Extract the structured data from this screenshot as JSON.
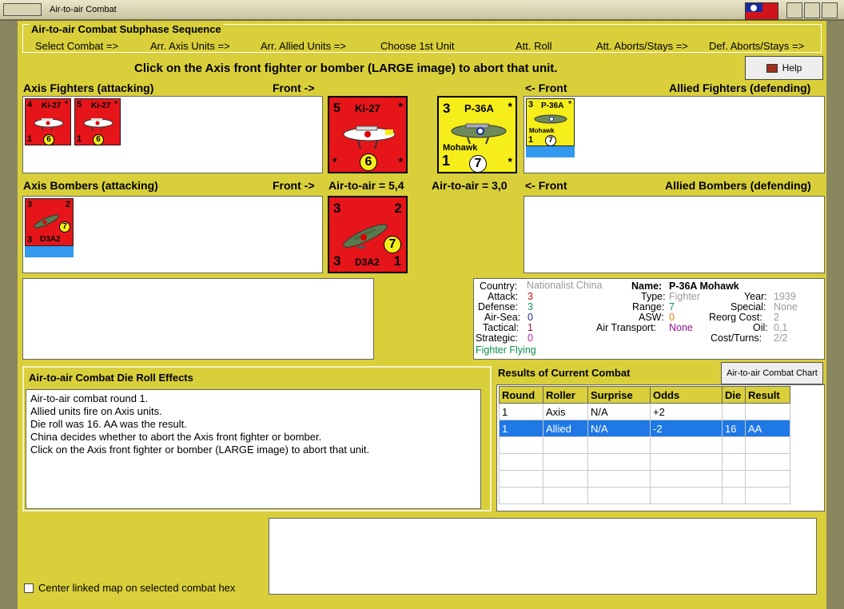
{
  "window": {
    "title": "Air-to-air Combat"
  },
  "sequence": {
    "label": "Air-to-air Combat Subphase Sequence",
    "steps": [
      "Select Combat =>",
      "Arr. Axis Units =>",
      "Arr. Allied Units =>",
      "Choose 1st Unit",
      "Att. Roll",
      "Att. Aborts/Stays =>",
      "Def. Aborts/Stays =>"
    ]
  },
  "instruction": "Click on the Axis front fighter or bomber  (LARGE image) to abort that unit.",
  "help_label": "Help",
  "headers": {
    "axis_fighters": "Axis Fighters (attacking)",
    "front_right_1": "Front ->",
    "front_left_1": "<- Front",
    "allied_fighters": "Allied Fighters (defending)",
    "axis_bombers": "Axis Bombers (attacking)",
    "front_right_2": "Front ->",
    "air_axis": "Air-to-air = 5,4",
    "air_allied": "Air-to-air = 3,0",
    "front_left_2": "<- Front",
    "allied_bombers": "Allied Bombers (defending)"
  },
  "counters": {
    "ki27_small_1": {
      "tl": "4",
      "name": "Ki-27",
      "val": "6",
      "bl": "1",
      "tr": "*"
    },
    "ki27_small_2": {
      "tl": "5",
      "name": "Ki-27",
      "val": "6",
      "bl": "1",
      "tr": "*"
    },
    "ki27_large": {
      "tl": "5",
      "name": "Ki-27",
      "val": "6",
      "bl": "*",
      "tr": "*",
      "br": "*"
    },
    "p36_large": {
      "tl": "3",
      "name": "P-36A",
      "sub": "Mohawk",
      "val": "7",
      "bl": "1",
      "tr": "*",
      "br": "*"
    },
    "p36_small": {
      "tl": "3",
      "name": "P-36A",
      "sub": "Mohawk",
      "val": "7",
      "bl": "1",
      "tr": "*"
    },
    "d3a2_small": {
      "tl": "3",
      "tr": "2",
      "name": "D3A2",
      "val": "7",
      "bl": "3"
    },
    "d3a2_large": {
      "tl": "3",
      "tr": "2",
      "name": "D3A2",
      "val": "7",
      "bl": "3",
      "br": "1"
    }
  },
  "info": {
    "country_label": "Country:",
    "country": "Nationalist China",
    "attack_label": "Attack:",
    "attack": "3",
    "defense_label": "Defense:",
    "defense": "3",
    "airsea_label": "Air-Sea:",
    "airsea": "0",
    "tactical_label": "Tactical:",
    "tactical": "1",
    "strategic_label": "Strategic:",
    "strategic": "0",
    "status": "Fighter Flying",
    "name_label": "Name:",
    "name": "P-36A Mohawk",
    "type_label": "Type:",
    "type": "Fighter",
    "range_label": "Range:",
    "range": "7",
    "asw_label": "ASW:",
    "asw": "0",
    "airtrans_label": "Air Transport:",
    "airtrans": "None",
    "year_label": "Year:",
    "year": "1939",
    "special_label": "Special:",
    "special": "None",
    "reorg_label": "Reorg Cost:",
    "reorg": "2",
    "oil_label": "Oil:",
    "oil": "0,1",
    "cost_label": "Cost/Turns:",
    "cost": "2/2"
  },
  "die_roll": {
    "title": "Air-to-air Combat Die Roll Effects",
    "lines": [
      "Air-to-air combat round 1.",
      "Allied units fire on Axis units.",
      "Die roll was 16.  AA was the result.",
      "China decides whether to abort the Axis front fighter or bomber.",
      "Click on the Axis front fighter or bomber  (LARGE image) to abort that unit."
    ]
  },
  "results": {
    "title": "Results of Current Combat",
    "chart_button": "Air-to-air Combat Chart",
    "columns": [
      "Round",
      "Roller",
      "Surprise",
      "Odds",
      "Die",
      "Result"
    ],
    "rows": [
      [
        "1",
        "Axis",
        "N/A",
        "+2",
        "",
        ""
      ],
      [
        "1",
        "Allied",
        "N/A",
        "-2",
        "16",
        "AA"
      ]
    ]
  },
  "center_label": "Center linked map on selected combat hex",
  "colors": {
    "panel": "#d9cf3a",
    "axis": "#e5151a",
    "allied": "#f6ee1a",
    "select": "#1e78e6"
  }
}
